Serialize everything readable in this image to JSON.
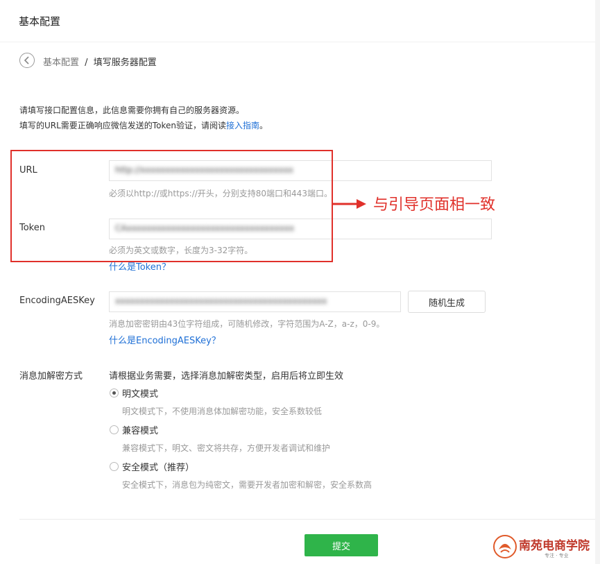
{
  "page": {
    "title": "基本配置"
  },
  "breadcrumb": {
    "parent": "基本配置",
    "separator": "/",
    "current": "填写服务器配置"
  },
  "intro": {
    "line1": "请填写接口配置信息，此信息需要你拥有自己的服务器资源。",
    "line2_prefix": "填写的URL需要正确响应微信发送的Token验证，请阅读",
    "line2_link": "接入指南",
    "line2_suffix": "。"
  },
  "url": {
    "label": "URL",
    "value": "http://xxxxxxxxxxxxxxxxxxxxxxxxxxxxxxx",
    "hint": "必须以http://或https://开头，分别支持80端口和443端口。"
  },
  "token": {
    "label": "Token",
    "value": "CAxxxxxxxxxxxxxxxxxxxxxxxxxxxxxxxxxx",
    "hint": "必须为英文或数字，长度为3-32字符。",
    "help_link": "什么是Token？"
  },
  "aeskey": {
    "label": "EncodingAESKey",
    "value": "xxxxxxxxxxxxxxxxxxxxxxxxxxxxxxxxxxxxxxxxxxx",
    "generate_button": "随机生成",
    "hint": "消息加密密钥由43位字符组成，可随机修改，字符范围为A-Z，a-z，0-9。",
    "help_link": "什么是EncodingAESKey？"
  },
  "encryption": {
    "label": "消息加解密方式",
    "description": "请根据业务需要，选择消息加解密类型，启用后将立即生效",
    "options": [
      {
        "label": "明文模式",
        "desc": "明文模式下，不使用消息体加解密功能，安全系数较低",
        "selected": true
      },
      {
        "label": "兼容模式",
        "desc": "兼容模式下，明文、密文将共存，方便开发者调试和维护",
        "selected": false
      },
      {
        "label": "安全模式（推荐）",
        "desc": "安全模式下，消息包为纯密文，需要开发者加密和解密，安全系数高",
        "selected": false
      }
    ]
  },
  "annotation": {
    "text": "与引导页面相一致",
    "color": "#e0302a"
  },
  "submit_label": "提交",
  "watermark": {
    "name": "南苑电商学院",
    "tagline": "专注 · 专业"
  },
  "colors": {
    "accent_green": "#2fb44a",
    "link_blue": "#1e6fd6",
    "annotation_red": "#e0302a"
  }
}
